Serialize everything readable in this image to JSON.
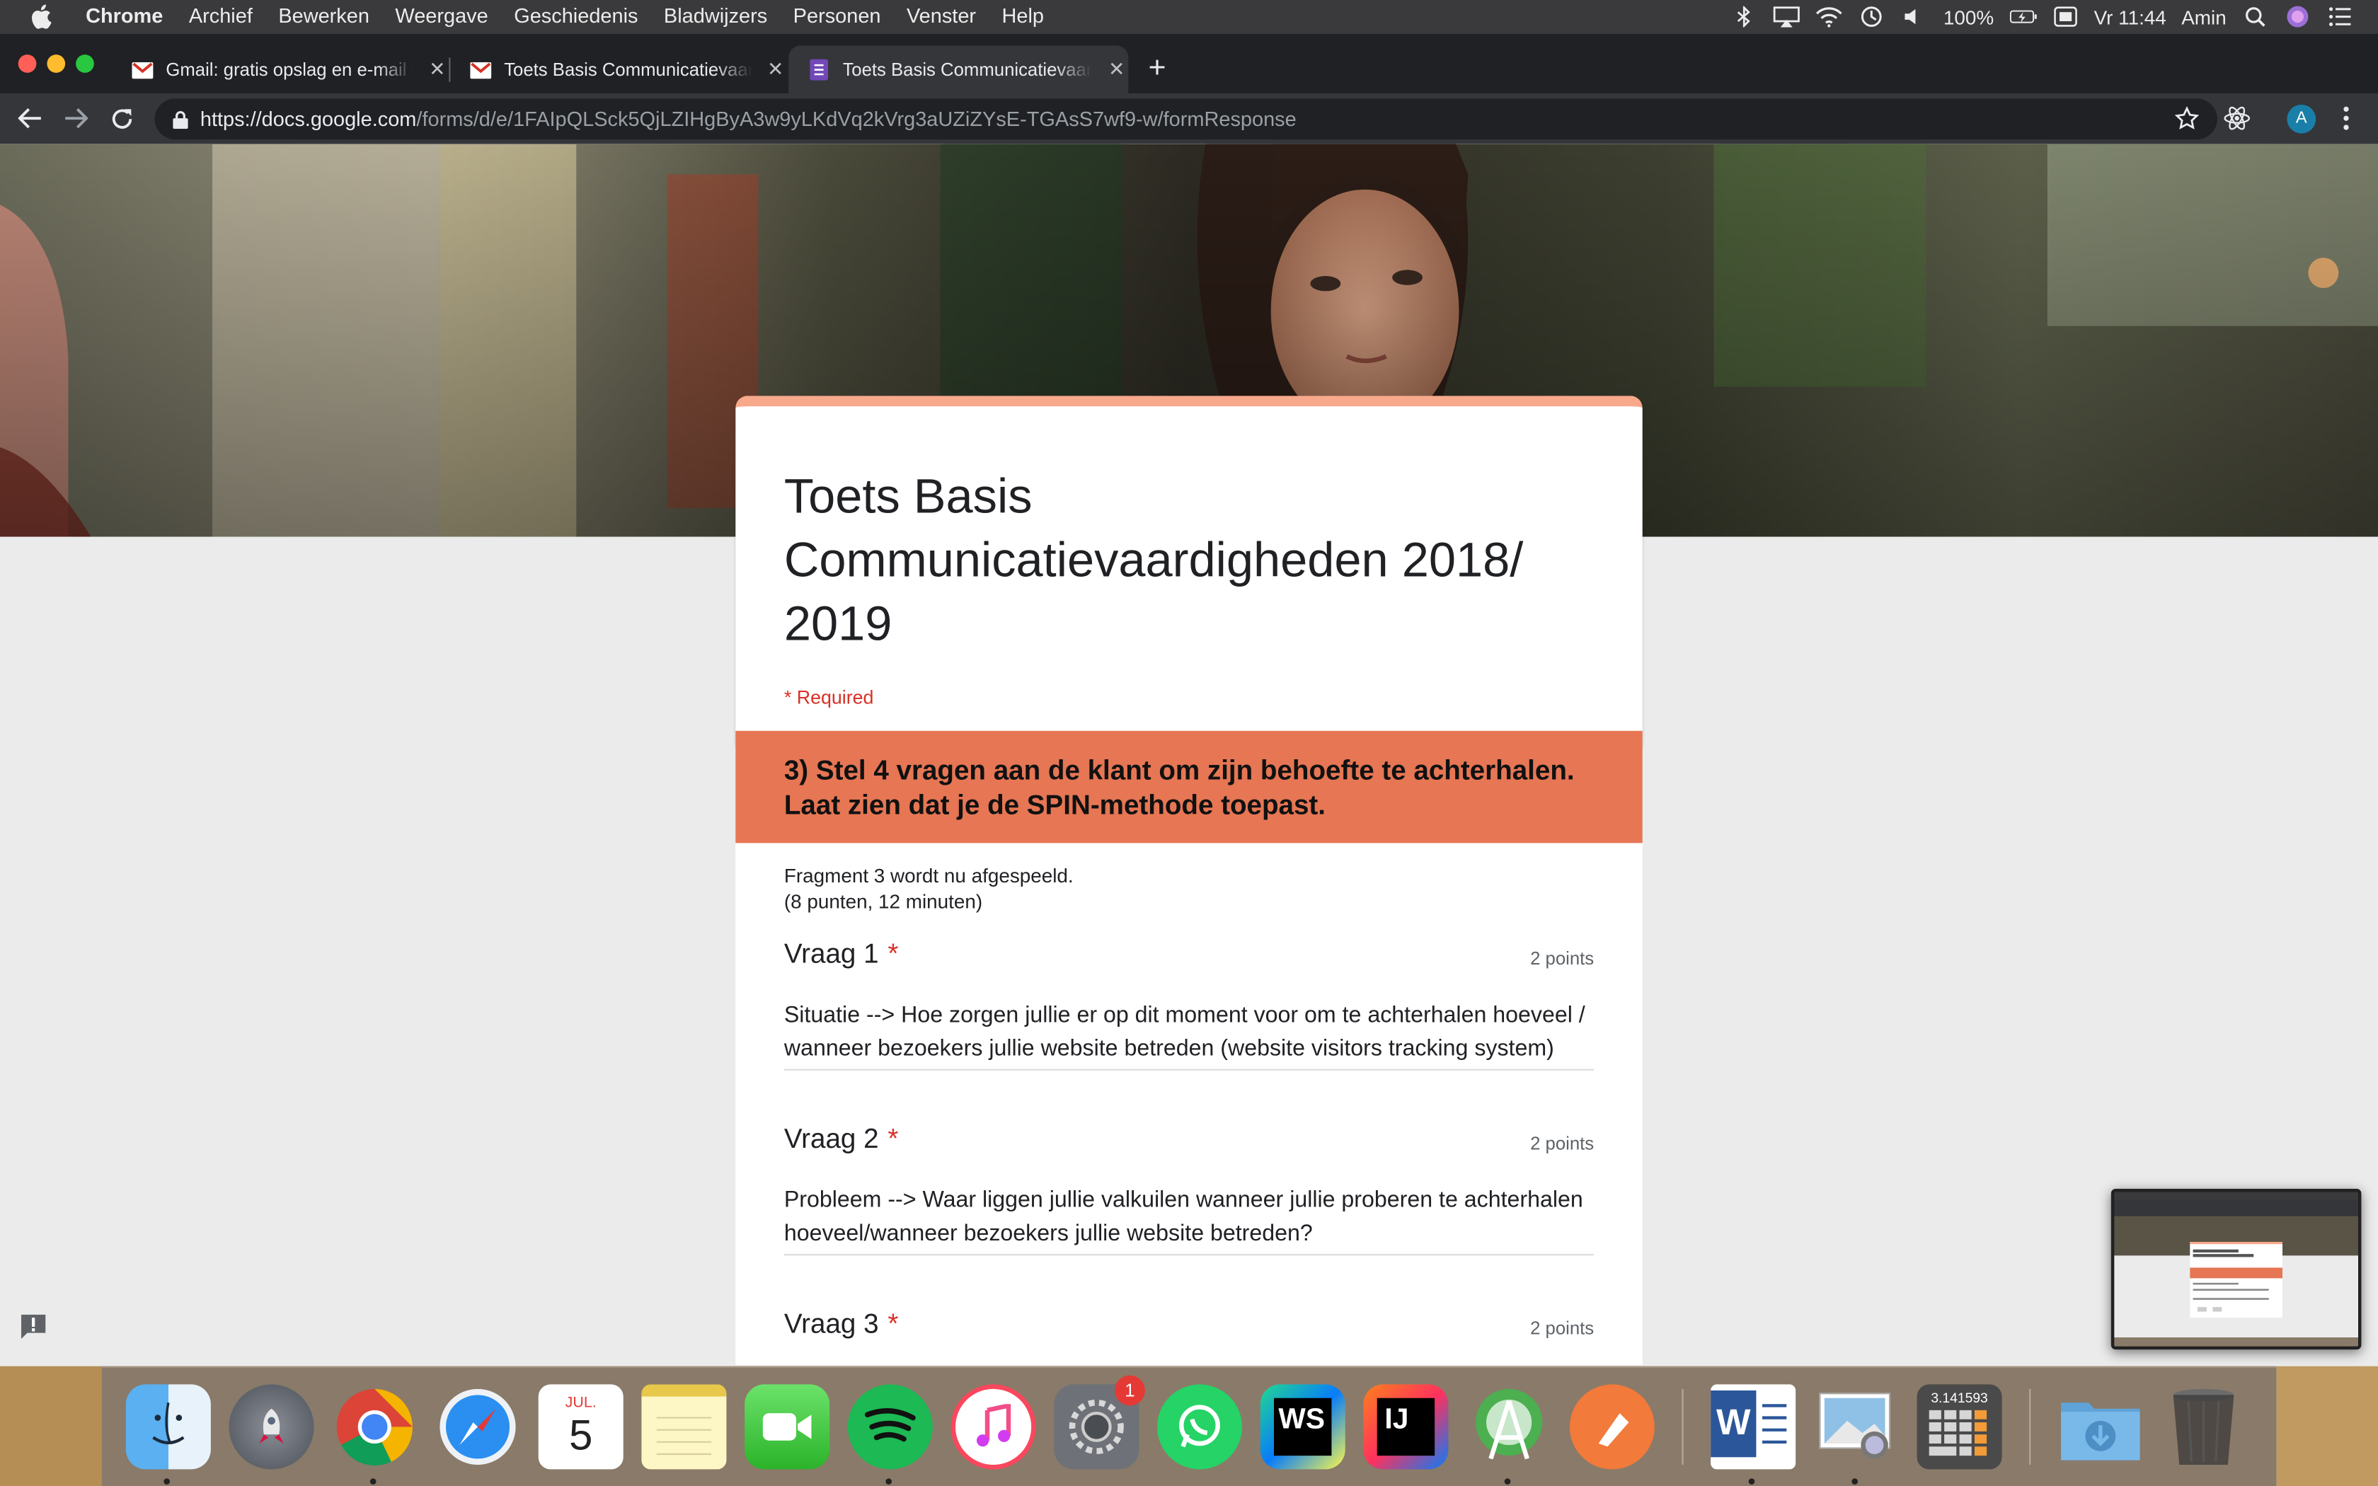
{
  "menubar": {
    "items": [
      "Chrome",
      "Archief",
      "Bewerken",
      "Weergave",
      "Geschiedenis",
      "Bladwijzers",
      "Personen",
      "Venster",
      "Help"
    ],
    "battery": "100%",
    "clock": "Vr 11:44",
    "user": "Amin"
  },
  "browser": {
    "tabs": [
      {
        "title": "Gmail: gratis opslag en e-mail van Google",
        "icon": "gmail-icon"
      },
      {
        "title": "Toets Basis Communicatievaardigheden",
        "icon": "gmail-icon"
      },
      {
        "title": "Toets Basis Communicatievaardigheden",
        "icon": "google-forms-icon",
        "active": true
      }
    ],
    "url_host": "https://docs.google.com",
    "url_path": "/forms/d/e/1FAIpQLSck5QjLZIHgByA3w9yLKdVq2kVrg3aUZiZYsE-TGAsS7wf9-w/formResponse",
    "profile_initial": "A"
  },
  "form": {
    "title": "Toets Basis Communicatievaardigheden 2018/ 2019",
    "required_note": "* Required",
    "section_title": "3) Stel 4 vragen aan de klant om zijn behoefte te achterhalen. Laat zien dat je de SPIN-methode toepast.",
    "section_desc_1": "Fragment 3 wordt nu afgespeeld.",
    "section_desc_2": "(8 punten, 12 minuten)",
    "questions": [
      {
        "label": "Vraag 1",
        "star": "*",
        "points": "2 points",
        "answer": "Situatie --> Hoe zorgen jullie er op dit moment voor om te achterhalen hoeveel / wanneer bezoekers jullie website betreden (website visitors tracking system)"
      },
      {
        "label": "Vraag 2",
        "star": "*",
        "points": "2 points",
        "answer": "Probleem --> Waar liggen jullie valkuilen wanneer jullie proberen te achterhalen hoeveel/wanneer bezoekers jullie website betreden?"
      },
      {
        "label": "Vraag 3",
        "star": "*",
        "points": "2 points",
        "answer": ""
      }
    ]
  },
  "dock": {
    "calendar_month": "JUL.",
    "calendar_day": "5",
    "settings_badge": "1",
    "webstorm_label": "WS",
    "intellij_label": "IJ",
    "word_label": "W",
    "calculator_display": "3.141593",
    "apps": [
      "finder-icon",
      "launchpad-icon",
      "chrome-icon",
      "safari-icon",
      "calendar-icon",
      "notes-icon",
      "facetime-icon",
      "spotify-icon",
      "itunes-icon",
      "system-preferences-icon",
      "whatsapp-icon",
      "webstorm-icon",
      "intellij-icon",
      "android-studio-icon",
      "sketch-icon",
      "word-icon",
      "preview-icon",
      "calculator-icon",
      "downloads-folder-icon",
      "trash-icon"
    ]
  },
  "colors": {
    "form_accent": "#f8a98c",
    "section_header": "#e67654",
    "required_red": "#d93025"
  }
}
